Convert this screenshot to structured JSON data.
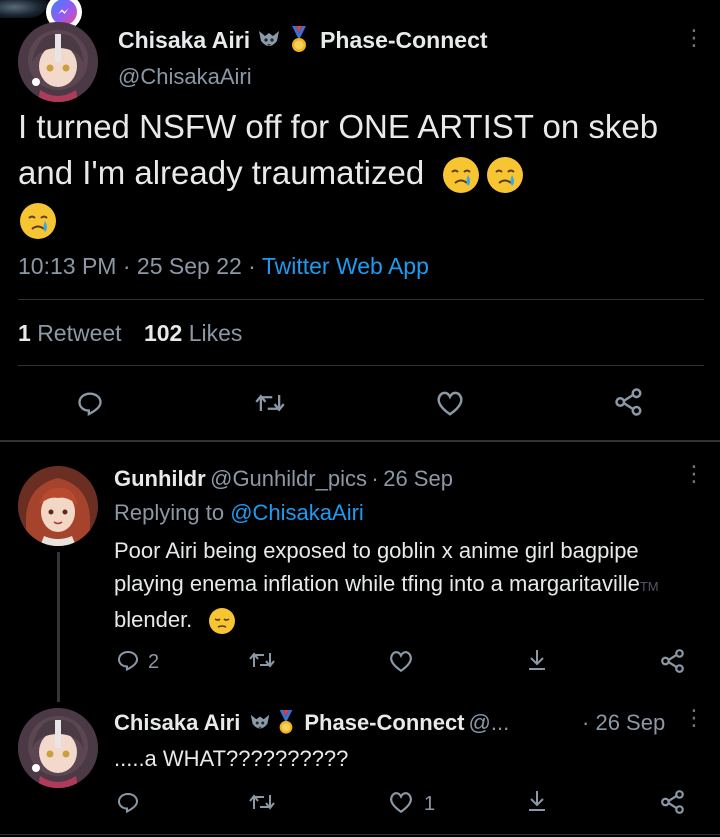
{
  "tweet": {
    "author_name": "Chisaka Airi",
    "author_affiliation": "Phase-Connect",
    "author_handle": "@ChisakaAiri",
    "text": "I turned NSFW off for ONE ARTIST on skeb and I'm already traumatized",
    "time": "10:13 PM",
    "date": "25 Sep 22",
    "source": "Twitter Web App",
    "retweet_count": "1",
    "retweet_label": "Retweet",
    "like_count": "102",
    "like_label": "Likes",
    "separator": "·"
  },
  "replies": [
    {
      "author_name": "Gunhildr",
      "author_handle": "@Gunhildr_pics",
      "date": "26 Sep",
      "replying_prefix": "Replying to",
      "replying_to": "@ChisakaAiri",
      "text_before_tm": "Poor Airi being exposed to goblin x anime girl bagpipe playing enema inflation while tfing into a margaritaville",
      "tm": "TM",
      "text_after_tm": "blender.",
      "reply_count": "2"
    },
    {
      "author_name": "Chisaka Airi",
      "author_affiliation": "Phase-Connect",
      "author_handle": "@...",
      "date": "26 Sep",
      "text": ".....a WHAT??????????",
      "like_count": "1"
    }
  ],
  "icons": {
    "messenger": "messenger-icon",
    "reply": "reply-icon",
    "retweet": "retweet-icon",
    "like": "heart-icon",
    "share": "share-icon",
    "download": "download-icon",
    "more": "more-icon"
  },
  "colors": {
    "background": "#000000",
    "text": "#e7e9ea",
    "muted": "#8b98a5",
    "link": "#1d9bf0",
    "divider": "#2f3336"
  }
}
